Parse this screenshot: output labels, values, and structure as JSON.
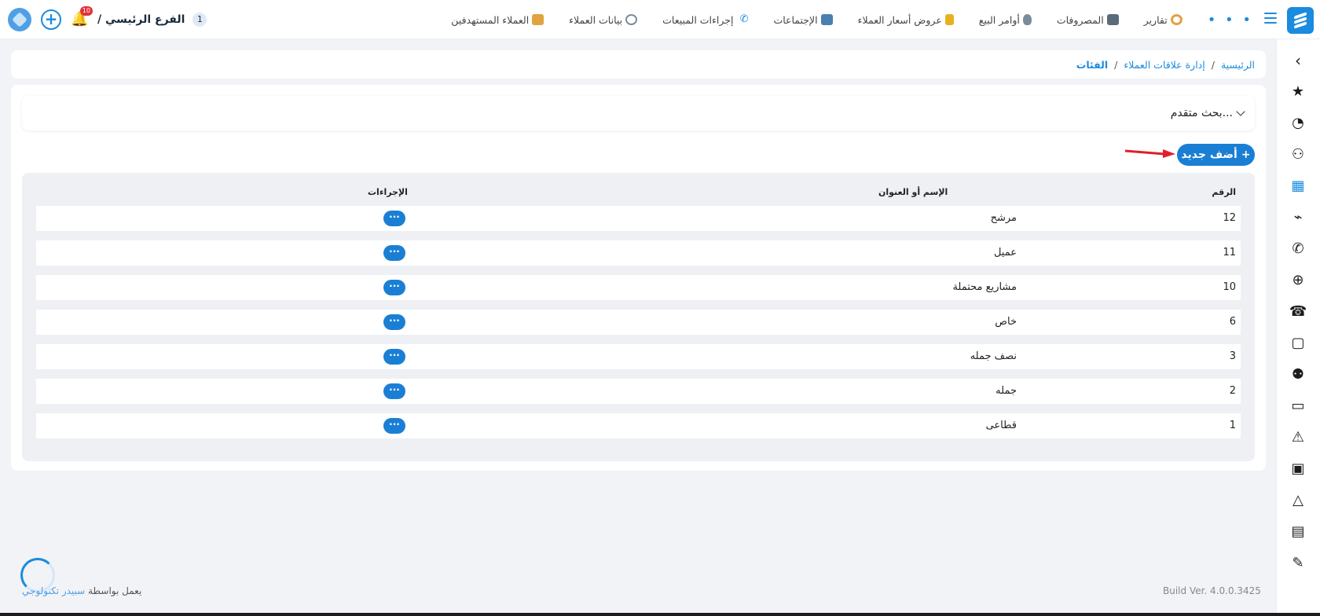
{
  "nav": {
    "items": [
      {
        "label": "العملاء المستهدفين",
        "icon": "target-customers-icon",
        "color": "#e0a340"
      },
      {
        "label": "بيانات العملاء",
        "icon": "customer-data-icon",
        "color": "#7a8b9a"
      },
      {
        "label": "إجراءات المبيعات",
        "icon": "phone-icon",
        "color": "#1a8bdf"
      },
      {
        "label": "الإجتماعات",
        "icon": "presentation-icon",
        "color": "#4a7fb0"
      },
      {
        "label": "عروض أسعار العملاء",
        "icon": "quote-icon",
        "color": "#e8b020"
      },
      {
        "label": "أوامر البيع",
        "icon": "money-bag-icon",
        "color": "#7a8b9a"
      },
      {
        "label": "المصروفات",
        "icon": "laptop-icon",
        "color": "#5a6b7a"
      },
      {
        "label": "تقارير",
        "icon": "chart-icon",
        "color": "#e0a340"
      }
    ],
    "more": "• • •"
  },
  "top_left": {
    "branch_label": "الفرع الرئيسي /",
    "branch_number": "1",
    "notifications_count": "10"
  },
  "breadcrumb": {
    "home": "الرئيسية",
    "section": "إدارة علاقات العملاء",
    "current": "الفئات",
    "separator": "/"
  },
  "advanced_search": {
    "label": "بحث متقدم..."
  },
  "add_button": {
    "label": "أضف جديد",
    "icon": "+"
  },
  "table": {
    "headers": {
      "number": "الرقم",
      "name": "الإسم أو العنوان",
      "actions": "الإجراءات"
    },
    "rows": [
      {
        "number": "12",
        "name": "مرشح"
      },
      {
        "number": "11",
        "name": "عميل"
      },
      {
        "number": "10",
        "name": "مشاريع محتملة"
      },
      {
        "number": "6",
        "name": "خاص"
      },
      {
        "number": "3",
        "name": "نصف جمله"
      },
      {
        "number": "2",
        "name": "جمله"
      },
      {
        "number": "1",
        "name": "قطاعى"
      }
    ],
    "action_label": "···"
  },
  "footer": {
    "powered_by": "يعمل بواسطة",
    "brand": "سبيدر تكنولوجي",
    "build": "Build Ver. 4.0.0.3425"
  },
  "colors": {
    "accent": "#1a8bdf",
    "button": "#1a7fd4",
    "badge": "#e0313c",
    "arrow": "#e0202a"
  }
}
